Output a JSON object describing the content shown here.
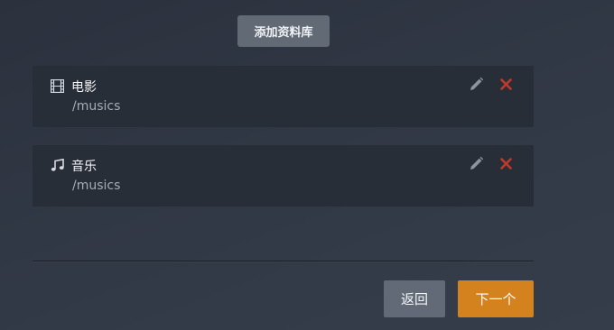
{
  "toolbar": {
    "add_library_label": "添加资料库"
  },
  "libraries": [
    {
      "name": "电影",
      "path": "/musics",
      "icon": "film-icon"
    },
    {
      "name": "音乐",
      "path": "/musics",
      "icon": "music-note-icon"
    }
  ],
  "footer": {
    "back_label": "返回",
    "next_label": "下一个"
  },
  "colors": {
    "accent": "#d4821e",
    "delete": "#c0392b",
    "card_bg": "#282e38",
    "secondary_button": "#616a76"
  }
}
